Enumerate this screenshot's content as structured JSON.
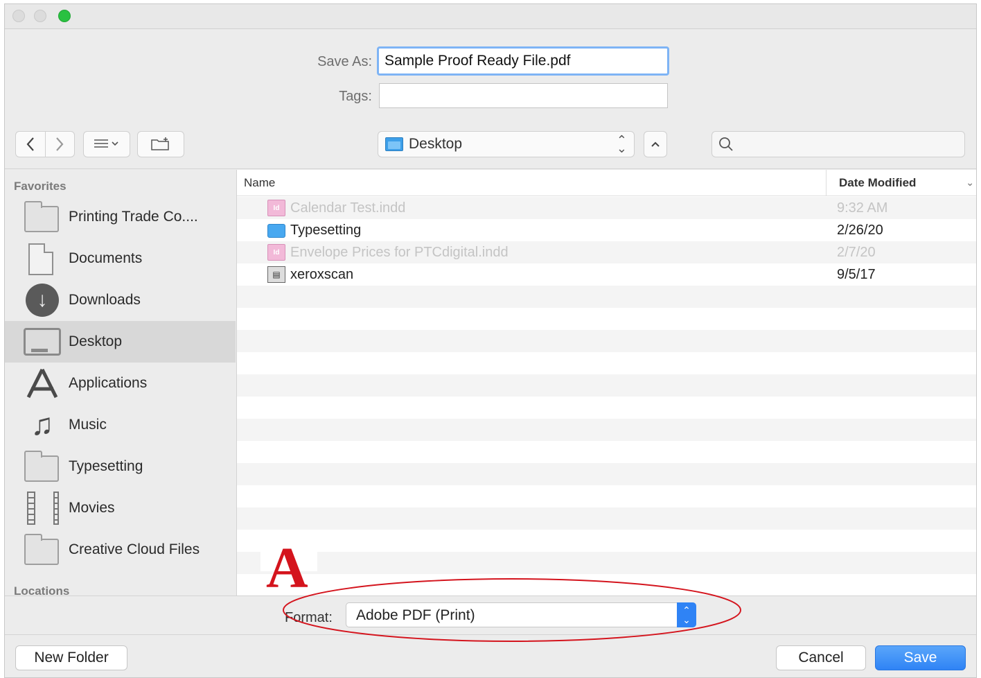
{
  "save_as": {
    "label": "Save As:",
    "value": "Sample Proof Ready File.pdf"
  },
  "tags": {
    "label": "Tags:",
    "value": ""
  },
  "toolbar": {
    "back_icon": "chevron-left-icon",
    "forward_icon": "chevron-right-icon",
    "view_icon": "list-view-icon",
    "new_folder_icon": "folder-plus-icon",
    "location": "Desktop",
    "search_placeholder": ""
  },
  "sidebar": {
    "favorites_header": "Favorites",
    "locations_header": "Locations",
    "items": [
      {
        "label": "Printing Trade Co....",
        "icon": "folder-icon"
      },
      {
        "label": "Documents",
        "icon": "document-icon"
      },
      {
        "label": "Downloads",
        "icon": "download-icon"
      },
      {
        "label": "Desktop",
        "icon": "desktop-icon",
        "selected": true
      },
      {
        "label": "Applications",
        "icon": "applications-icon"
      },
      {
        "label": "Music",
        "icon": "music-note-icon"
      },
      {
        "label": "Typesetting",
        "icon": "folder-icon"
      },
      {
        "label": "Movies",
        "icon": "film-icon"
      },
      {
        "label": "Creative Cloud Files",
        "icon": "folder-icon"
      }
    ]
  },
  "filelist": {
    "col_name": "Name",
    "col_date": "Date Modified",
    "rows": [
      {
        "name": "Calendar Test.indd",
        "date": "9:32 AM",
        "dim": true,
        "icon": "indesign-file-icon"
      },
      {
        "name": "Typesetting",
        "date": "2/26/20",
        "dim": false,
        "icon": "folder-icon"
      },
      {
        "name": "Envelope Prices for PTCdigital.indd",
        "date": "2/7/20",
        "dim": true,
        "icon": "indesign-file-icon"
      },
      {
        "name": "xeroxscan",
        "date": "9/5/17",
        "dim": false,
        "icon": "scanner-app-icon"
      }
    ]
  },
  "format": {
    "label": "Format:",
    "value": "Adobe PDF (Print)"
  },
  "buttons": {
    "new_folder": "New Folder",
    "cancel": "Cancel",
    "save": "Save"
  },
  "annotation": {
    "letter": "A",
    "color": "#d4141d"
  }
}
